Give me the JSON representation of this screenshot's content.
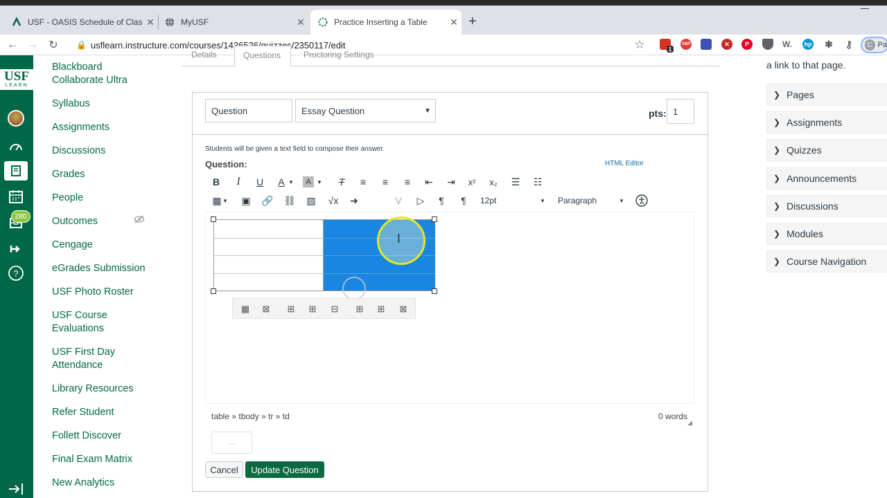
{
  "browser": {
    "tabs": [
      {
        "title": "USF - OASIS Schedule of Classes",
        "icon": "usf-favicon-icon"
      },
      {
        "title": "MyUSF",
        "icon": "globe-icon"
      },
      {
        "title": "Practice Inserting a Table",
        "icon": "canvas-favicon-icon"
      }
    ],
    "url": "usflearn.instructure.com/courses/1436526/quizzes/2350117/edit",
    "profile_initial": "C",
    "profile_text": "Pa",
    "ext_badge": "1"
  },
  "global_nav": {
    "logo": "USF",
    "logo_sub": "LEARN",
    "inbox_badge": "280"
  },
  "course_nav": {
    "items": [
      "Blackboard Collaborate Ultra",
      "Syllabus",
      "Assignments",
      "Discussions",
      "Grades",
      "People",
      "Outcomes",
      "Cengage",
      "eGrades Submission",
      "USF Photo Roster",
      "USF Course Evaluations",
      "USF First Day Attendance",
      "Library Resources",
      "Refer Student",
      "Follett Discover",
      "Final Exam Matrix",
      "New Analytics"
    ]
  },
  "quiz_tabs": [
    "Details",
    "Questions",
    "Proctoring Settings"
  ],
  "question": {
    "name_value": "Question",
    "type_value": "Essay Question",
    "pts_label": "pts:",
    "pts_value": "1",
    "hint": "Students will be given a text field to compose their answer.",
    "label": "Question:",
    "html_editor": "HTML Editor",
    "font_size": "12pt",
    "block_format": "Paragraph",
    "path": "table » tbody » tr » td",
    "word_count": "0 words",
    "more_label": "...",
    "cancel": "Cancel",
    "update": "Update Question"
  },
  "right_panel": {
    "intro": "a link to that page.",
    "items": [
      "Pages",
      "Assignments",
      "Quizzes",
      "Announcements",
      "Discussions",
      "Modules",
      "Course Navigation"
    ]
  },
  "colors": {
    "usf_green": "#006747",
    "selection_blue": "#1a86e0",
    "highlight_yellow": "#e6e620"
  }
}
